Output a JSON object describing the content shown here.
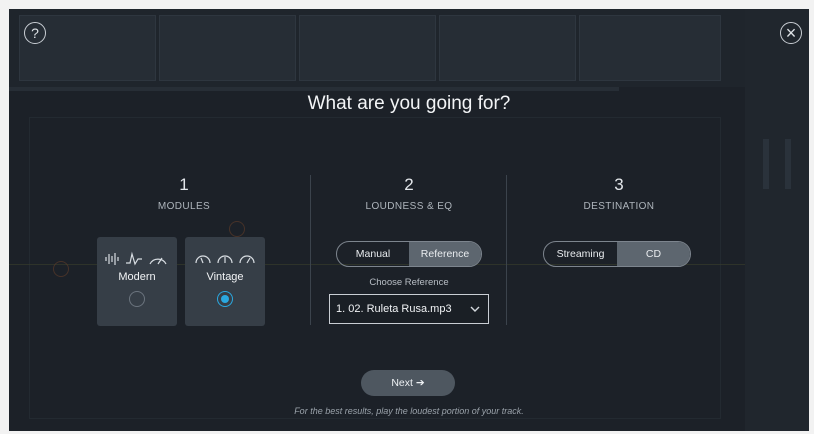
{
  "dialog": {
    "title": "What are you going for?",
    "help_icon": "question-icon",
    "close_icon": "close-icon"
  },
  "steps": [
    {
      "number": "1",
      "label": "MODULES"
    },
    {
      "number": "2",
      "label": "LOUDNESS & EQ"
    },
    {
      "number": "3",
      "label": "DESTINATION"
    }
  ],
  "modules": {
    "options": [
      {
        "name": "Modern",
        "icons": "waveform-icon, curve-icon, meter-icon",
        "selected": false
      },
      {
        "name": "Vintage",
        "icons": "vintage-knob-icons",
        "selected": true
      }
    ]
  },
  "loudness": {
    "mode_options": [
      "Manual",
      "Reference"
    ],
    "active_mode": "Reference",
    "choose_label": "Choose Reference",
    "reference_value": "1. 02. Ruleta Rusa.mp3"
  },
  "destination": {
    "options": [
      "Streaming",
      "CD"
    ],
    "active": "CD"
  },
  "footer": {
    "next_label": "Next ➔",
    "hint": "For the best results, play the loudest portion of your track."
  },
  "colors": {
    "background": "#1c2128",
    "card": "#363e47",
    "accent": "#2aa8e0",
    "active_segment": "#5d666f"
  }
}
